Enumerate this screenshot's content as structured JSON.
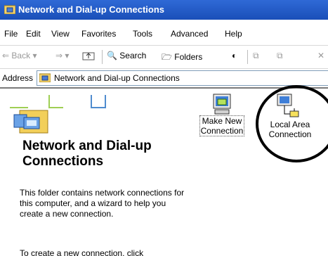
{
  "window": {
    "title": "Network and Dial-up Connections"
  },
  "menu": [
    "File",
    "Edit",
    "View",
    "Favorites",
    "Tools",
    "Advanced",
    "Help"
  ],
  "toolbar": {
    "back": "Back",
    "search": "Search",
    "folders": "Folders"
  },
  "address": {
    "label": "Address",
    "value": "Network and Dial-up Connections"
  },
  "left_pane": {
    "heading": "Network and Dial-up Connections",
    "description": "This folder contains network connections for this computer, and a wizard to help you create a new connection.",
    "tip": "To create a new connection, click"
  },
  "items": [
    {
      "line1": "Make New",
      "line2": "Connection"
    },
    {
      "line1": "Local Area",
      "line2": "Connection"
    }
  ]
}
